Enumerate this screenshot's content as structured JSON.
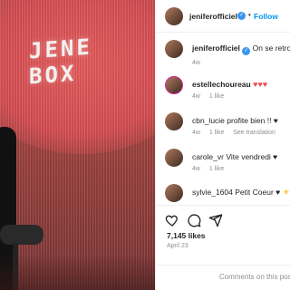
{
  "photo": {
    "sign_line1": "JENE",
    "sign_line2": "BOX"
  },
  "post": {
    "author": "jeniferofficiel",
    "dot": "•",
    "follow_label": "Follow"
  },
  "comments": [
    {
      "user": "jeniferofficiel",
      "text": "On se retrouv",
      "time": "4w",
      "likes": "",
      "translate": ""
    },
    {
      "user": "estellechoureau",
      "text": "♥♥♥",
      "time": "4w",
      "likes": "1 like",
      "translate": ""
    },
    {
      "user": "cbn_lucie",
      "text": "profite bien !! ♥",
      "time": "4w",
      "likes": "1 like",
      "translate": "See translation"
    },
    {
      "user": "carole_vr",
      "text": "Vite vendredi ♥",
      "time": "4w",
      "likes": "1 like",
      "translate": ""
    },
    {
      "user": "sylvie_1604",
      "text": "Petit Coeur ♥",
      "time": "",
      "likes": "",
      "translate": ""
    }
  ],
  "footer": {
    "likes": "7,145 likes",
    "date": "April 23",
    "comments_note": "Comments on this pos"
  },
  "colors": {
    "accent": "#0095f6",
    "heart": "#ed4956",
    "verified": "#3897f0"
  }
}
